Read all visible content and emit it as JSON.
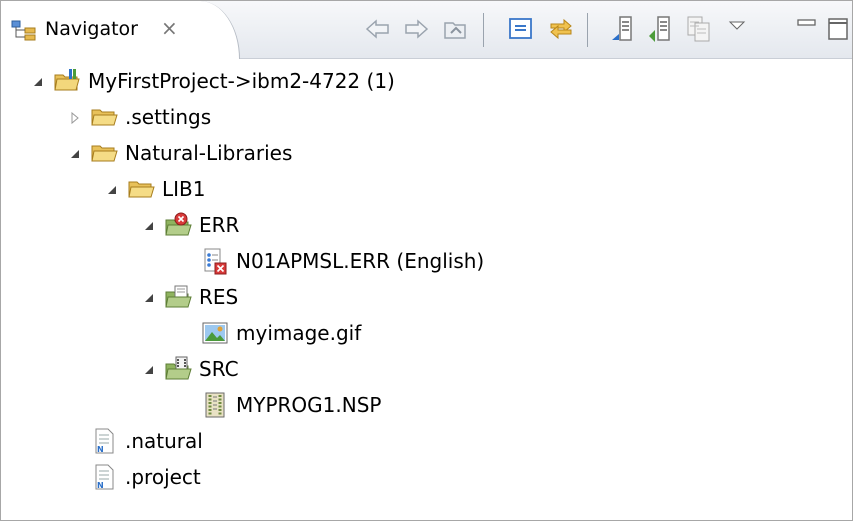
{
  "view": {
    "tab_title": "Navigator",
    "close_glyph": "×",
    "toolbar": [
      "back-icon",
      "forward-icon",
      "up-icon",
      "collapse-all-icon",
      "link-with-editor-icon",
      "upload-icon",
      "download-icon",
      "compare-icon",
      "view-menu-icon",
      "minimize-icon",
      "maximize-icon"
    ]
  },
  "tree": [
    {
      "label": "MyFirstProject->ibm2-4722 (1)",
      "level": 0,
      "expanded": true,
      "icon": "project-icon"
    },
    {
      "label": ".settings",
      "level": 1,
      "expanded": false,
      "icon": "folder-icon"
    },
    {
      "label": "Natural-Libraries",
      "level": 1,
      "expanded": true,
      "icon": "folder-icon"
    },
    {
      "label": "LIB1",
      "level": 2,
      "expanded": true,
      "icon": "folder-icon"
    },
    {
      "label": "ERR",
      "level": 3,
      "expanded": true,
      "icon": "error-folder-icon"
    },
    {
      "label": "N01APMSL.ERR (English)",
      "level": 4,
      "expanded": null,
      "icon": "error-file-icon"
    },
    {
      "label": "RES",
      "level": 3,
      "expanded": true,
      "icon": "resource-folder-icon"
    },
    {
      "label": "myimage.gif",
      "level": 4,
      "expanded": null,
      "icon": "image-file-icon"
    },
    {
      "label": "SRC",
      "level": 3,
      "expanded": true,
      "icon": "source-folder-icon"
    },
    {
      "label": "MYPROG1.NSP",
      "level": 4,
      "expanded": null,
      "icon": "program-file-icon"
    },
    {
      "label": ".natural",
      "level": 1,
      "expanded": null,
      "icon": "natural-file-icon"
    },
    {
      "label": ".project",
      "level": 1,
      "expanded": null,
      "icon": "natural-file-icon"
    }
  ],
  "colors": {
    "folder": "#e8c15a",
    "folder_green": "#8fb35f",
    "accent_blue": "#2a6fc9",
    "error_red": "#d83a3a"
  }
}
